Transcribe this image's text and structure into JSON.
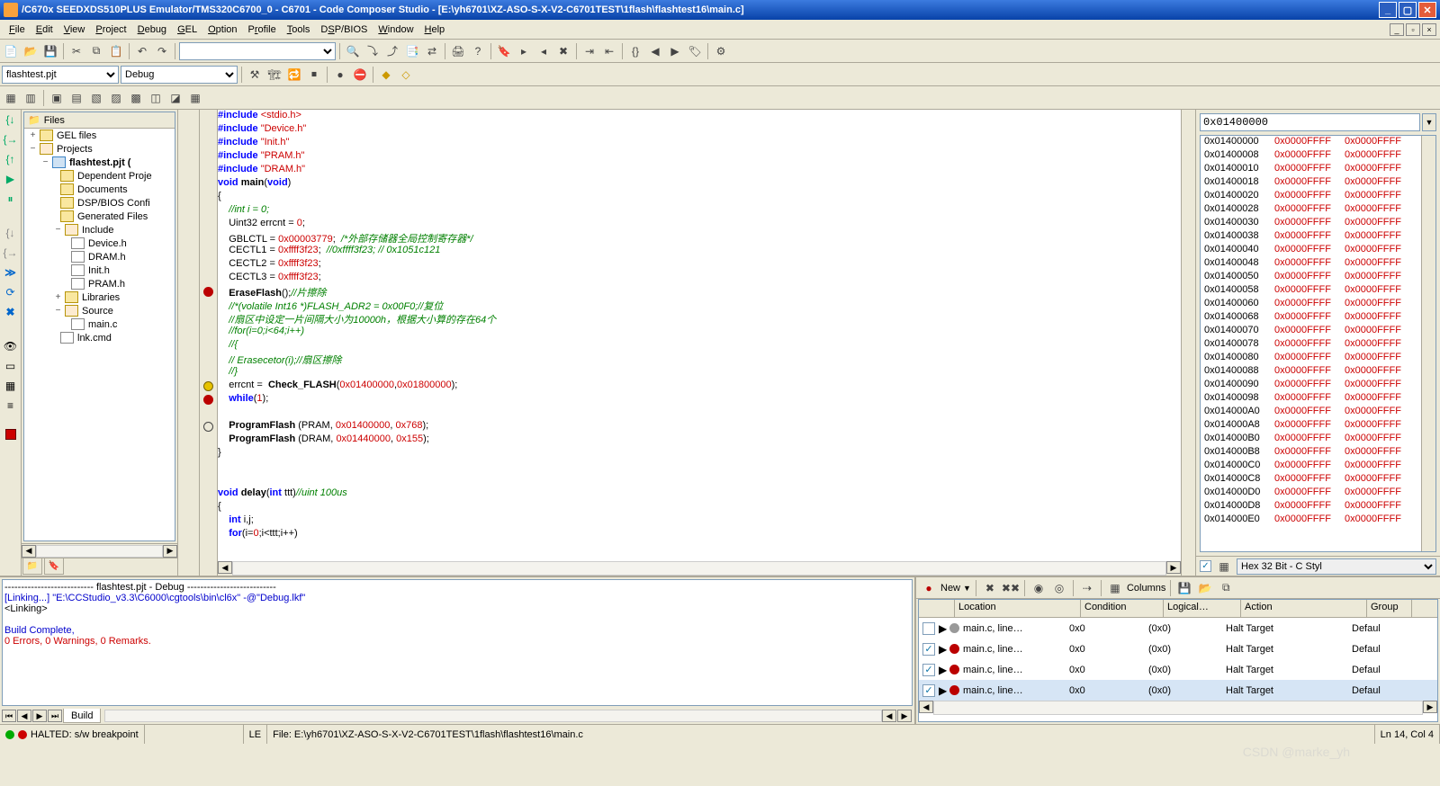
{
  "title": "/C670x SEEDXDS510PLUS Emulator/TMS320C6700_0 - C6701 - Code Composer Studio - [E:\\yh6701\\XZ-ASO-S-X-V2-C6701TEST\\1flash\\flashtest16\\main.c]",
  "menu": [
    "File",
    "Edit",
    "View",
    "Project",
    "Debug",
    "GEL",
    "Option",
    "Profile",
    "Tools",
    "DSP/BIOS",
    "Window",
    "Help"
  ],
  "project_combo": "flashtest.pjt",
  "config_combo": "Debug",
  "tree": {
    "header": "Files",
    "gel": "GEL files",
    "projects": "Projects",
    "projname": "flashtest.pjt (",
    "deps": "Dependent Proje",
    "docs": "Documents",
    "dspbios": "DSP/BIOS Confi",
    "genfiles": "Generated Files",
    "include": "Include",
    "inc_files": [
      "Device.h",
      "DRAM.h",
      "Init.h",
      "PRAM.h"
    ],
    "libs": "Libraries",
    "source": "Source",
    "src_files": [
      "main.c"
    ],
    "lnk": "lnk.cmd"
  },
  "code_lines": [
    {
      "t": "#include <stdio.h>",
      "cls": "inc"
    },
    {
      "t": "#include \"Device.h\"",
      "cls": "inc"
    },
    {
      "t": "#include \"Init.h\"",
      "cls": "inc"
    },
    {
      "t": "#include \"PRAM.h\"",
      "cls": "inc"
    },
    {
      "t": "#include \"DRAM.h\"",
      "cls": "inc"
    },
    {
      "t": "void main(void)",
      "cls": "sig"
    },
    {
      "t": "{",
      "cls": "plain"
    },
    {
      "t": "    //int i = 0;",
      "cls": "cmt"
    },
    {
      "t": "    Uint32 errcnt = 0;",
      "cls": "decl"
    },
    {
      "t": "    GBLCTL = 0x00003779; /*外部存储器全局控制寄存器*/",
      "cls": "stmt1"
    },
    {
      "t": "    CECTL1 = 0xffff3f23; //0xffff3f23; // 0x1051c121",
      "cls": "stmt1"
    },
    {
      "t": "    CECTL2 = 0xffff3f23;",
      "cls": "stmt2"
    },
    {
      "t": "    CECTL3 = 0xffff3f23;",
      "cls": "stmt2"
    },
    {
      "t": "    EraseFlash();//片擦除",
      "cls": "erase",
      "bp": "red"
    },
    {
      "t": "    //*(volatile Int16 *)FLASH_ADR2 = 0x00F0;//复位",
      "cls": "cmt"
    },
    {
      "t": "    //扇区中设定一片间隔大小为10000h，根据大小算的存在64个",
      "cls": "cmt"
    },
    {
      "t": "    //for(i=0;i<64;i++)",
      "cls": "cmt"
    },
    {
      "t": "    //{",
      "cls": "cmt"
    },
    {
      "t": "    // Erasecetor(i);//扇区擦除",
      "cls": "cmt"
    },
    {
      "t": "    //}",
      "cls": "cmt"
    },
    {
      "t": "    errcnt =  Check_FLASH(0x01400000,0x01800000);",
      "cls": "check",
      "bp": "yellow"
    },
    {
      "t": "    while(1);",
      "cls": "while",
      "bp": "red"
    },
    {
      "t": "",
      "cls": "plain"
    },
    {
      "t": "    ProgramFlash (PRAM, 0x01400000, 0x768);",
      "cls": "prog",
      "bp": "hollow"
    },
    {
      "t": "    ProgramFlash (DRAM, 0x01440000, 0x155);",
      "cls": "prog"
    },
    {
      "t": "}",
      "cls": "plain"
    },
    {
      "t": "",
      "cls": "plain"
    },
    {
      "t": "",
      "cls": "plain"
    },
    {
      "t": "void delay(int ttt)//uint 100us",
      "cls": "delay"
    },
    {
      "t": "{",
      "cls": "plain"
    },
    {
      "t": "    int i,j;",
      "cls": "kw"
    },
    {
      "t": "    for(i=0;i<ttt;i++)",
      "cls": "kw2"
    }
  ],
  "memory": {
    "addr_input": "0x01400000",
    "rows": [
      "0x01400000",
      "0x01400008",
      "0x01400010",
      "0x01400018",
      "0x01400020",
      "0x01400028",
      "0x01400030",
      "0x01400038",
      "0x01400040",
      "0x01400048",
      "0x01400050",
      "0x01400058",
      "0x01400060",
      "0x01400068",
      "0x01400070",
      "0x01400078",
      "0x01400080",
      "0x01400088",
      "0x01400090",
      "0x01400098",
      "0x014000A0",
      "0x014000A8",
      "0x014000B0",
      "0x014000B8",
      "0x014000C0",
      "0x014000C8",
      "0x014000D0",
      "0x014000D8",
      "0x014000E0"
    ],
    "val": "0x0000FFFF",
    "format": "Hex 32 Bit - C Styl"
  },
  "output": {
    "header_line": "---------------------------  flashtest.pjt - Debug  ---------------------------",
    "linking": "[Linking...] \"E:\\CCStudio_v3.3\\C6000\\cgtools\\bin\\cl6x\" -@\"Debug.lkf\"",
    "linking2": "<Linking>",
    "complete": "Build Complete,",
    "errors": "  0 Errors, 0 Warnings, 0 Remarks.",
    "tab": "Build"
  },
  "bkpt": {
    "new_label": "New",
    "cols_label": "Columns",
    "headers": [
      "",
      "Location",
      "Condition",
      "Logical…",
      "Action",
      "Group"
    ],
    "rows": [
      {
        "chk": false,
        "dot": "gray",
        "loc": "main.c, line…",
        "cond": "0x0",
        "log": "(0x0)",
        "act": "Halt Target",
        "grp": "Defaul"
      },
      {
        "chk": true,
        "dot": "red",
        "loc": "main.c, line…",
        "cond": "0x0",
        "log": "(0x0)",
        "act": "Halt Target",
        "grp": "Defaul"
      },
      {
        "chk": true,
        "dot": "red",
        "loc": "main.c, line…",
        "cond": "0x0",
        "log": "(0x0)",
        "act": "Halt Target",
        "grp": "Defaul"
      },
      {
        "chk": true,
        "dot": "red",
        "loc": "main.c, line…",
        "cond": "0x0",
        "log": "(0x0)",
        "act": "Halt Target",
        "grp": "Defaul",
        "sel": true
      }
    ]
  },
  "status": {
    "halted": "HALTED: s/w breakpoint",
    "le": "LE",
    "file": "File: E:\\yh6701\\XZ-ASO-S-X-V2-C6701TEST\\1flash\\flashtest16\\main.c",
    "lncol": "Ln 14, Col 4",
    "watermark": "CSDN @marke_yh"
  }
}
